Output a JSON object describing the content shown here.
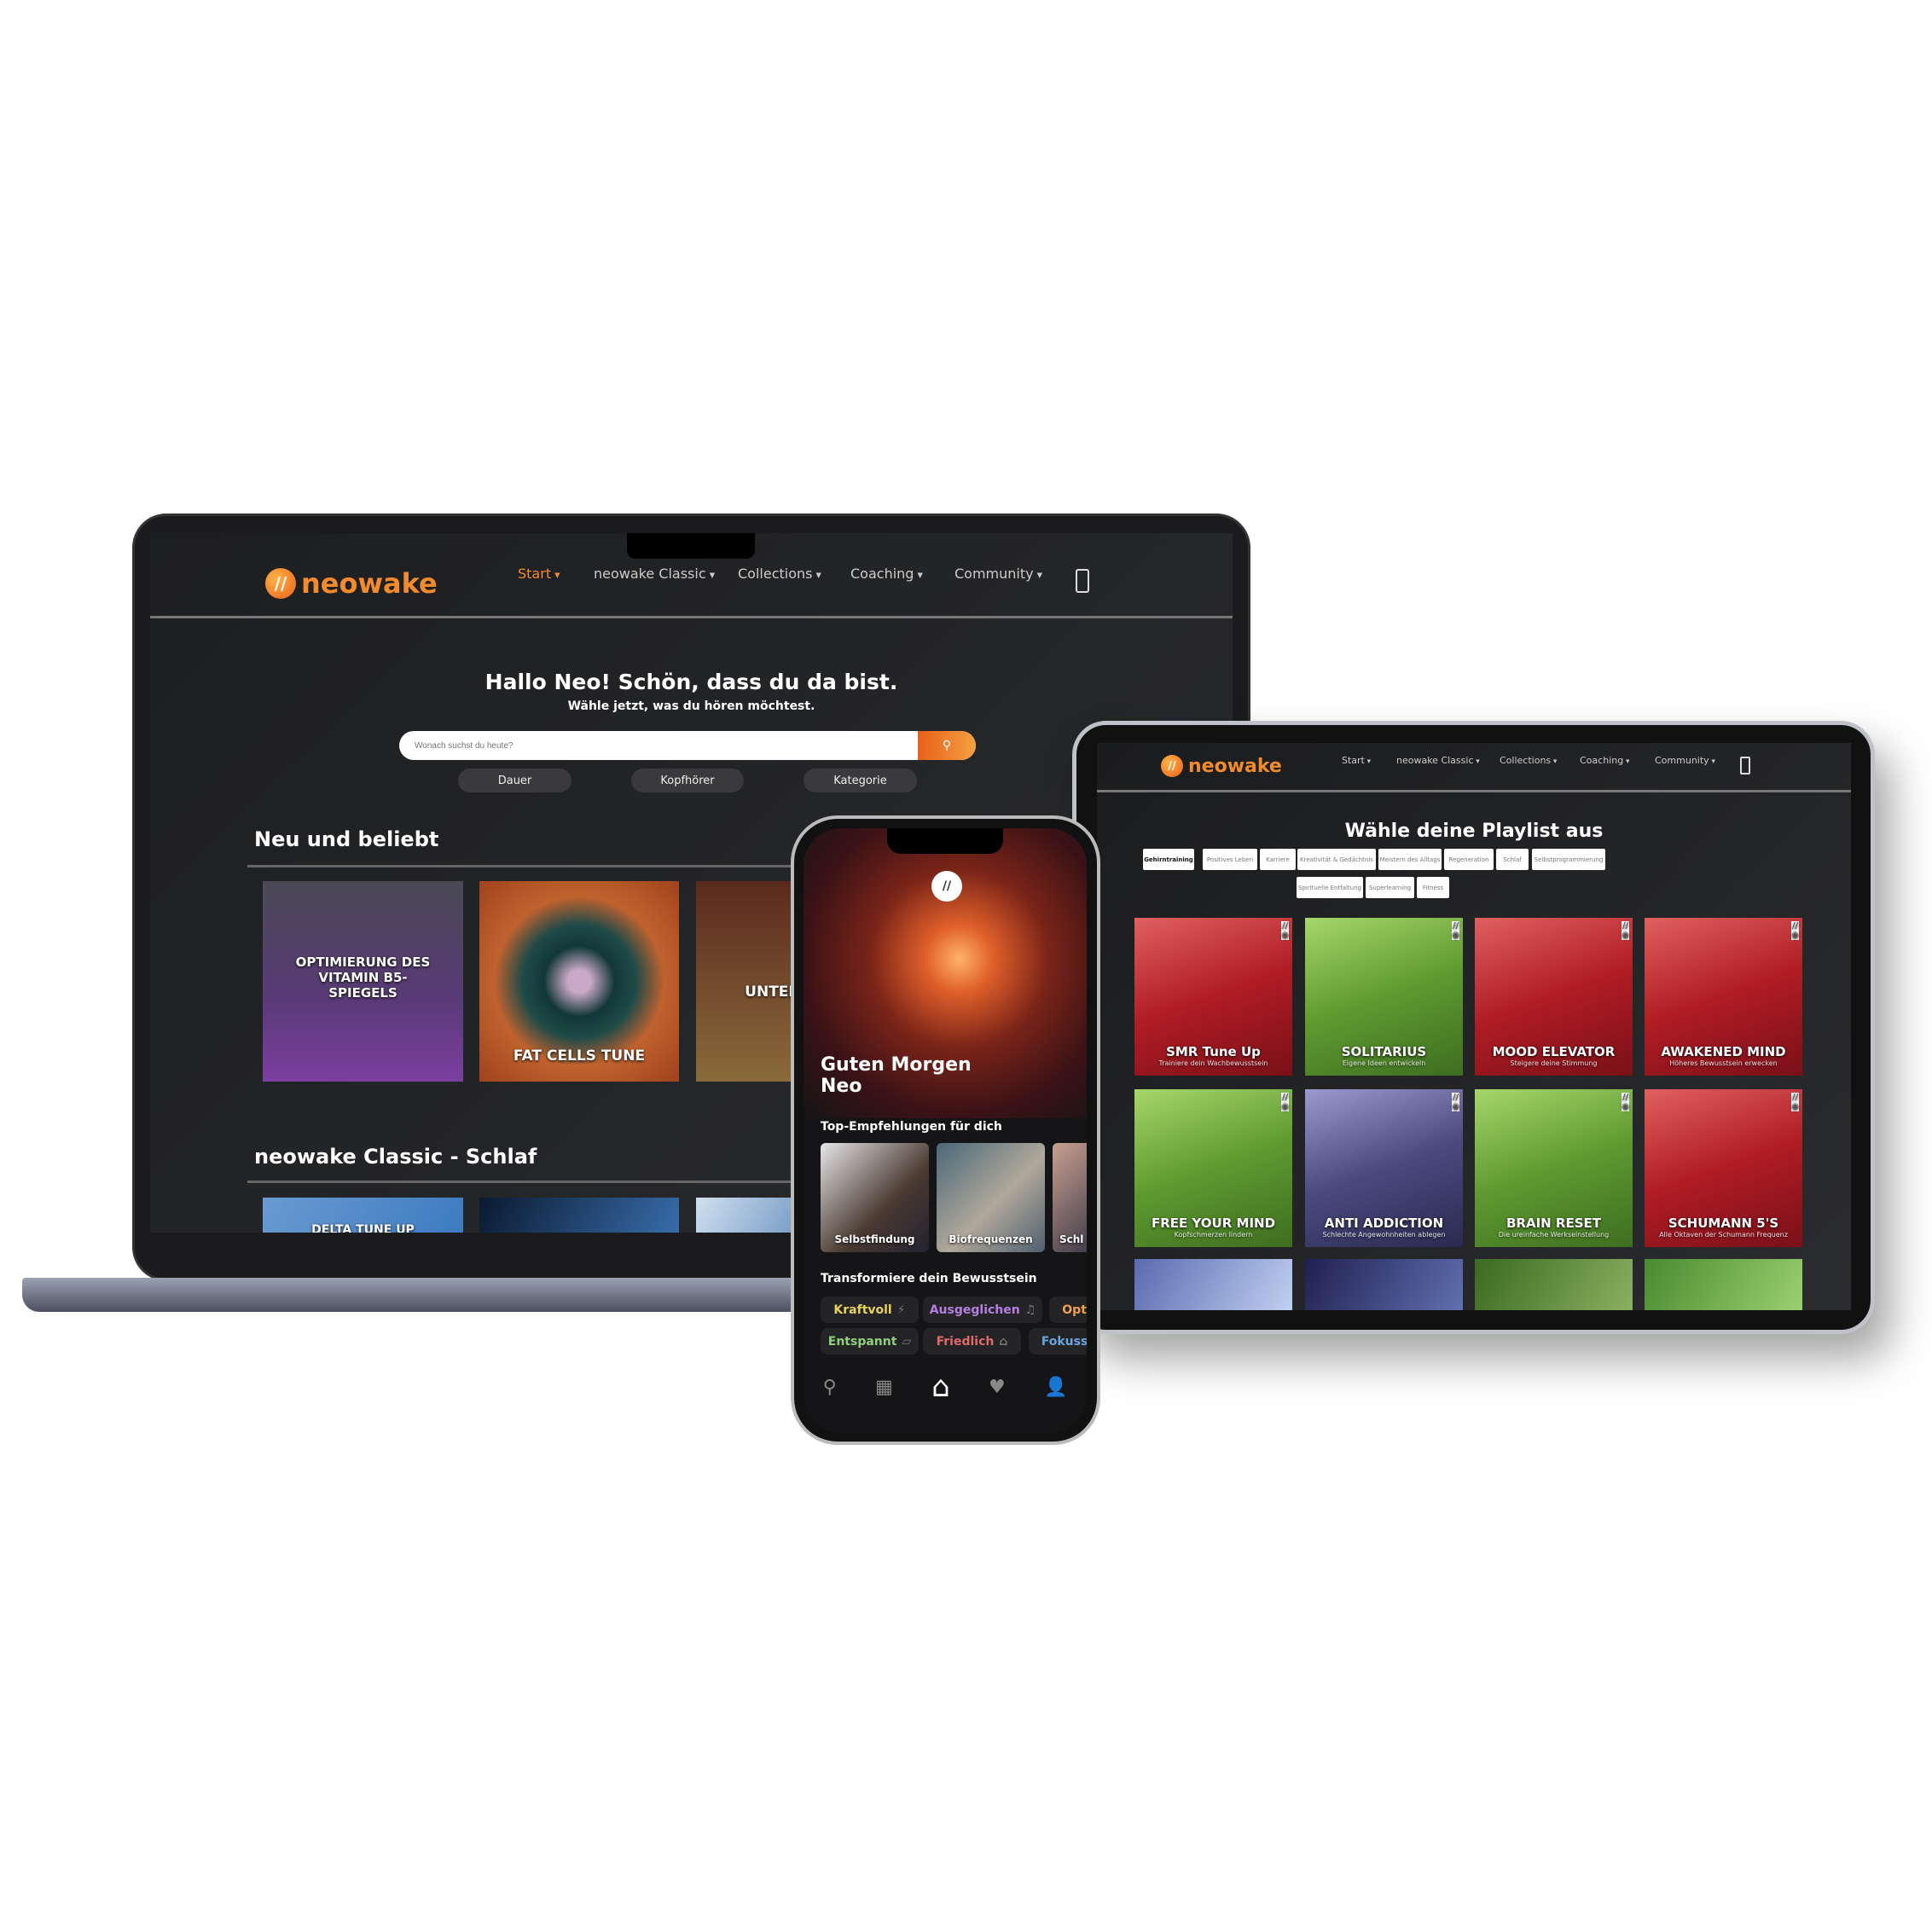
{
  "brand": {
    "name": "neowake",
    "accent": "#f28a2e"
  },
  "laptop": {
    "nav": [
      "Start",
      "neowake Classic",
      "Collections",
      "Coaching",
      "Community"
    ],
    "greeting": "Hallo  Neo!   Schön, dass du da bist.",
    "subtitle": "Wähle jetzt, was du hören möchtest.",
    "search_placeholder": "Wonach suchst du heute?",
    "filters": [
      "Dauer",
      "Kopfhörer",
      "Kategorie"
    ],
    "section1": "Neu und beliebt",
    "cards": [
      {
        "title": "OPTIMIERUNG DES VITAMIN B5-SPIEGELS"
      },
      {
        "title": "FAT CELLS TUNE"
      },
      {
        "title": "UNTERS DEP"
      }
    ],
    "section2": "neowake Classic - Schlaf",
    "cards2": [
      {
        "title": "DELTA TUNE UP"
      }
    ]
  },
  "tablet": {
    "nav": [
      "Start",
      "neowake Classic",
      "Collections",
      "Coaching",
      "Community"
    ],
    "title": "Wähle deine Playlist aus",
    "tabs": [
      "Gehirntraining",
      "Positives Leben",
      "Karriere",
      "Kreativität & Gedächtnis",
      "Meistern des Alltags",
      "Regeneration",
      "Schlaf",
      "Selbstprogrammierung",
      "Spirituelle Entfaltung",
      "Superlearning",
      "Fitness"
    ],
    "active_tab": "Gehirntraining",
    "playlists": [
      {
        "title": "SMR Tune Up",
        "subtitle": "Trainiere dein Wachbewusstsein",
        "color": "red"
      },
      {
        "title": "SOLITARIUS",
        "subtitle": "Eigene Ideen entwickeln",
        "color": "green"
      },
      {
        "title": "MOOD ELEVATOR",
        "subtitle": "Steigere deine Stimmung",
        "color": "red"
      },
      {
        "title": "AWAKENED MIND",
        "subtitle": "Höheres Bewusstsein erwecken",
        "color": "red"
      },
      {
        "title": "FREE YOUR MIND",
        "subtitle": "Kopfschmerzen lindern",
        "color": "green"
      },
      {
        "title": "ANTI ADDICTION",
        "subtitle": "Schlechte Angewohnheiten ablegen",
        "color": "purple"
      },
      {
        "title": "BRAIN RESET",
        "subtitle": "Die ureinfache Werkseinstellung",
        "color": "green"
      },
      {
        "title": "SCHUMANN 5'S",
        "subtitle": "Alle Oktaven der Schumann Frequenz",
        "color": "red"
      }
    ]
  },
  "phone": {
    "greeting_line1": "Guten Morgen",
    "greeting_line2": "Neo",
    "recommend_title": "Top-Empfehlungen für dich",
    "recommendations": [
      "Selbstfindung",
      "Biofrequenzen",
      "Schl"
    ],
    "transform_title": "Transformiere dein Bewusstsein",
    "moods": [
      {
        "label": "Kraftvoll",
        "icon": "⚡",
        "color": "#e8d35a"
      },
      {
        "label": "Ausgeglichen",
        "icon": "♫",
        "color": "#b77fe0"
      },
      {
        "label": "Opti",
        "icon": "",
        "color": "#f0a050"
      },
      {
        "label": "Entspannt",
        "icon": "▱",
        "color": "#8fd17a"
      },
      {
        "label": "Friedlich",
        "icon": "⌂",
        "color": "#e06a6a"
      },
      {
        "label": "Fokuss",
        "icon": "",
        "color": "#6aa6e0"
      }
    ],
    "tabbar": [
      "search",
      "grid",
      "home",
      "heart",
      "user"
    ]
  }
}
